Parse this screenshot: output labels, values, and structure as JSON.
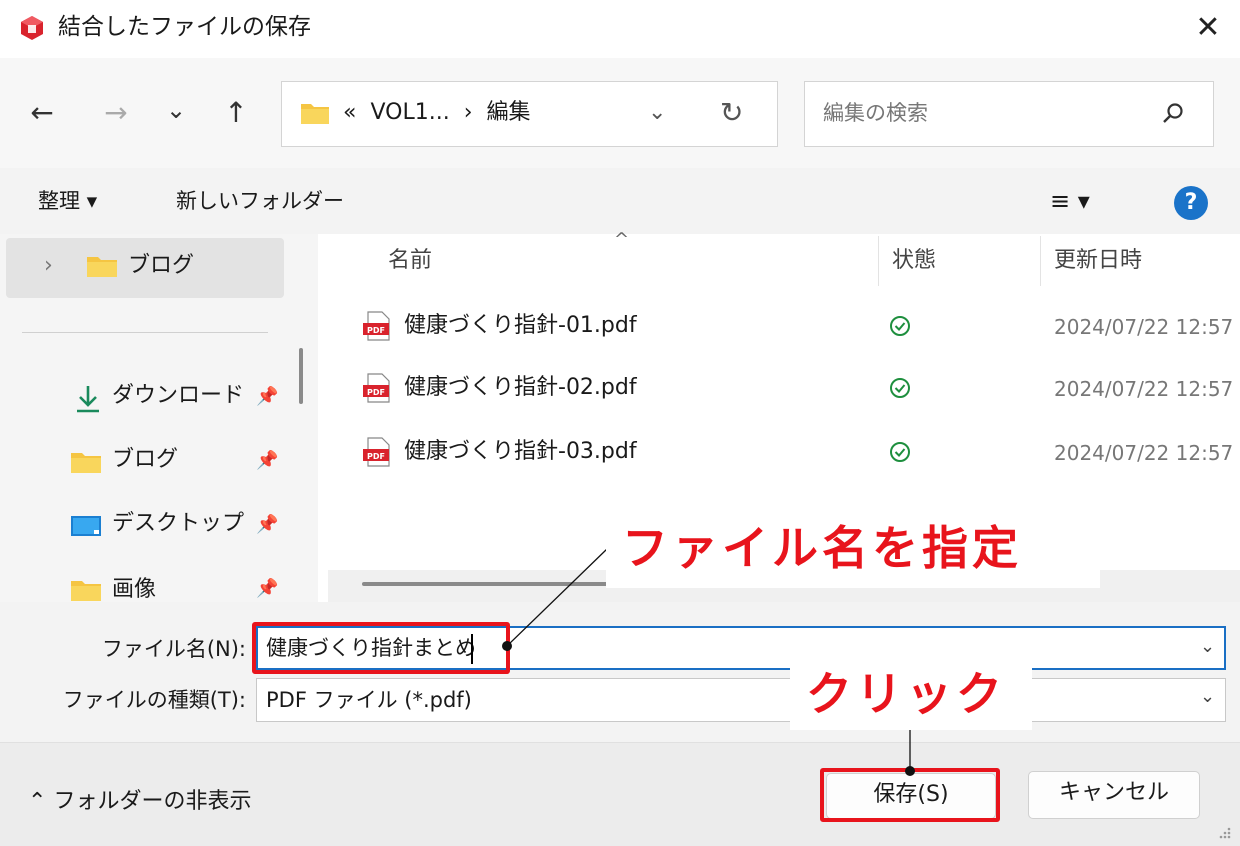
{
  "window": {
    "title": "結合したファイルの保存",
    "close_label": "✕"
  },
  "nav": {
    "back": "←",
    "forward": "→",
    "recent": "⌄",
    "up": "↑"
  },
  "address": {
    "path_prefix": "«",
    "path_folder": "VOL1...",
    "path_sep": "›",
    "path_current": "編集",
    "chevron": "⌄",
    "refresh": "↻"
  },
  "search": {
    "placeholder": "編集の検索"
  },
  "toolbar": {
    "organize": "整理 ▾",
    "new_folder": "新しいフォルダー",
    "view": "≡ ▾",
    "help": "?"
  },
  "sidebar": {
    "top_item": {
      "chevron": "›",
      "label": "ブログ"
    },
    "items": [
      {
        "label": "ダウンロード",
        "icon": "download-icon"
      },
      {
        "label": "ブログ",
        "icon": "folder-icon"
      },
      {
        "label": "デスクトップ",
        "icon": "desktop-icon"
      },
      {
        "label": "画像",
        "icon": "folder-icon"
      }
    ]
  },
  "filelist": {
    "headers": {
      "name": "名前",
      "status": "状態",
      "modified": "更新日時",
      "sort": "^"
    },
    "files": [
      {
        "name": "健康づくり指針-01.pdf",
        "modified": "2024/07/22 12:57"
      },
      {
        "name": "健康づくり指針-02.pdf",
        "modified": "2024/07/22 12:57"
      },
      {
        "name": "健康づくり指針-03.pdf",
        "modified": "2024/07/22 12:57"
      }
    ]
  },
  "form": {
    "filename_label": "ファイル名(N):",
    "filename_value": "健康づくり指針まとめ",
    "filetype_label": "ファイルの種類(T):",
    "filetype_value": "PDF ファイル (*.pdf)"
  },
  "footer": {
    "hide_folders": "フォルダーの非表示",
    "save": "保存(S)",
    "cancel": "キャンセル"
  },
  "annotations": {
    "filename_callout": "ファイル名を指定",
    "click_callout": "クリック"
  },
  "colors": {
    "accent": "#e8141c",
    "help_blue": "#1a73c9",
    "folder": "#f5c542",
    "check": "#1e8f3e"
  }
}
